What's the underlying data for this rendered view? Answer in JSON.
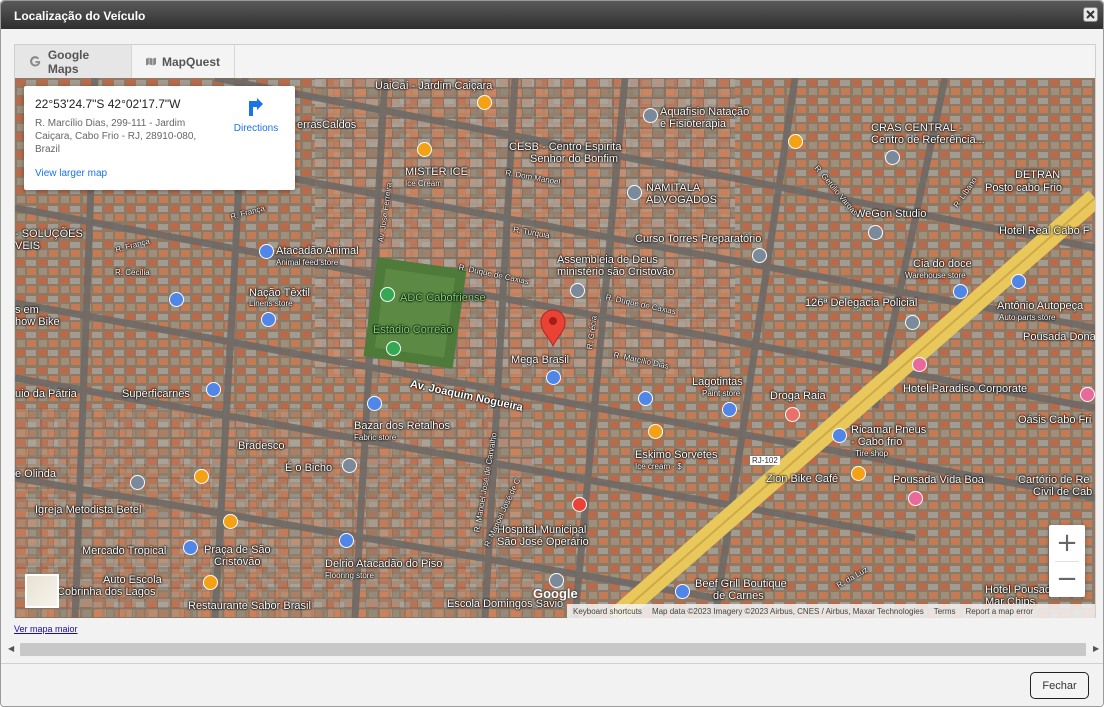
{
  "window": {
    "title": "Localização do Veículo"
  },
  "tabs": [
    {
      "label": "Google Maps",
      "icon": "google-g-icon",
      "active": true
    },
    {
      "label": "MapQuest",
      "icon": "map-icon",
      "active": false
    }
  ],
  "info_card": {
    "coordinates": "22°53'24.7\"S 42°02'17.7\"W",
    "address": "R. Marcílio Dias, 299-111 - Jardim Caiçara, Cabo Frio - RJ, 28910-080, Brazil",
    "directions_label": "Directions",
    "larger_map_label": "View larger map"
  },
  "map_labels": {
    "uaicai": "UaiCaí - Jardim Caiçara",
    "aquafisio": "Aquafisio Natação",
    "fisioterapia": "e Fisioterapia",
    "cras": "CRAS CENTRAL -",
    "cras2": "Centro de Referência...",
    "terras": "errasCaldos",
    "cesb": "CESB - Centro Espirita",
    "cesb2": "Senhor do Bonfim",
    "mister": "MISTER ICE",
    "mister_sub": "Ice Cream",
    "dom_manoel": "R. Dom Manoel",
    "namitala": "NAMITALA",
    "namitala2": "ADVOGADOS",
    "detran": "DETRAN",
    "detran2": "Posto cabo Frio",
    "wegon": "WeGon Studio",
    "r_franca1": "R. França",
    "r_franca2": "R. França",
    "soluc": "- SOLUÇÕES",
    "veis": "VEIS",
    "turquia": "R. Turquia",
    "curso": "Curso Torres Preparatório",
    "hotel_real": "Hotel Real Cabo F",
    "atacadao": "Atacadão Animal",
    "atacadao_sub": "Animal feed store",
    "assembleia": "Assembleia de Deus",
    "assembleia2": "ministério são Cristovão",
    "cia_doce": "Cia do doce",
    "cia_doce_sub": "Warehouse store",
    "r_cecilia": "R. Cecília",
    "duque1": "R. Duque de Caxias",
    "duque2": "R. Duque de Caxias",
    "nacao": "Nação Têxtil",
    "nacao_sub": "Linens store",
    "adc": "ADC Cabofriense",
    "delegacia": "126ª Delegacia Policial",
    "antonio": "Antônio Autopeça",
    "antonio_sub": "Auto parts store",
    "em": "s em",
    "bike": "how Bike",
    "estadio": "Estádio Correão",
    "pousada_dona": "Pousada Dona",
    "mega": "Mega Brasil",
    "marcilio": "R. Marcílio Dias",
    "lagotintas": "Lagotintas",
    "lagotintas_sub": "Paint store",
    "hotel_paradiso": "Hotel Paradiso Corporate",
    "patria": "uio da Pátria",
    "superfi": "Superficarnes",
    "joaquim": "Av. Joaquim Nogueira",
    "droga": "Droga Raia",
    "bazar": "Bazar dos Retalhos",
    "bazar_sub": "Fabric store",
    "oasis": "Oásis Cabo Fri",
    "ricamar": "Ricamar Pneus",
    "ricamar2": "- Cabo frio",
    "ricamar_sub": "Tire shop",
    "bradesco": "Bradesco",
    "eskimo": "Eskimo Sorvetes",
    "eskimo_sub": "Ice cream · $",
    "rj102": "RJ-102",
    "olinda": "e Olinda",
    "bicho": "É o Bicho",
    "zion": "Zion Bike Café",
    "pousada_vida": "Pousada Vida Boa",
    "cartorio": "Cartório de Re",
    "cartorio2": "Civil de Cab",
    "metodista": "Igreja Metodista Betel",
    "hospital": "Hospital Municipal",
    "hospital2": "São José Operário",
    "mercado": "Mercado Tropical",
    "praca": "Praça de São",
    "praca2": "Cristóvão",
    "delrio": "Delrio Atacadão do Piso",
    "delrio_sub": "Flooring store",
    "auto_escola": "Auto Escola",
    "auto_escola2": "Cobrinha dos Lagos",
    "restaurante": "Restaurante Sabor Brasil",
    "escola": "Escola Domingos Savio",
    "beef": "Beef Grill Boutique",
    "beef2": "de Carnes",
    "hotel_pousada": "Hotel Pousada",
    "mar_chips": "Mar Chips",
    "r_luz": "R. da Luz",
    "jose_ferreira": "Av. José Ferreira",
    "graca": "R. Grécia",
    "getulio": "R. Getúlio Vargas",
    "libano": "R. Líbano",
    "jose_carvalho": "R. Manoel José de Carvalho",
    "manoel_jc": "R. Manoel José de C"
  },
  "map_controls": {
    "zoom_in": "+",
    "zoom_out": "−",
    "google_logo": "Google",
    "keyboard": "Keyboard shortcuts",
    "map_data": "Map data ©2023 Imagery ©2023 Airbus, CNES / Airbus, Maxar Technologies",
    "terms": "Terms",
    "report": "Report a map error"
  },
  "links": {
    "ver_mapa_maior": "Ver mapa maior"
  },
  "footer": {
    "close_label": "Fechar"
  },
  "colors": {
    "title_bar": "#3c3c3c",
    "link_blue": "#1a73e8",
    "pin_red": "#ea4335",
    "road_yellow": "#e8c85a"
  }
}
